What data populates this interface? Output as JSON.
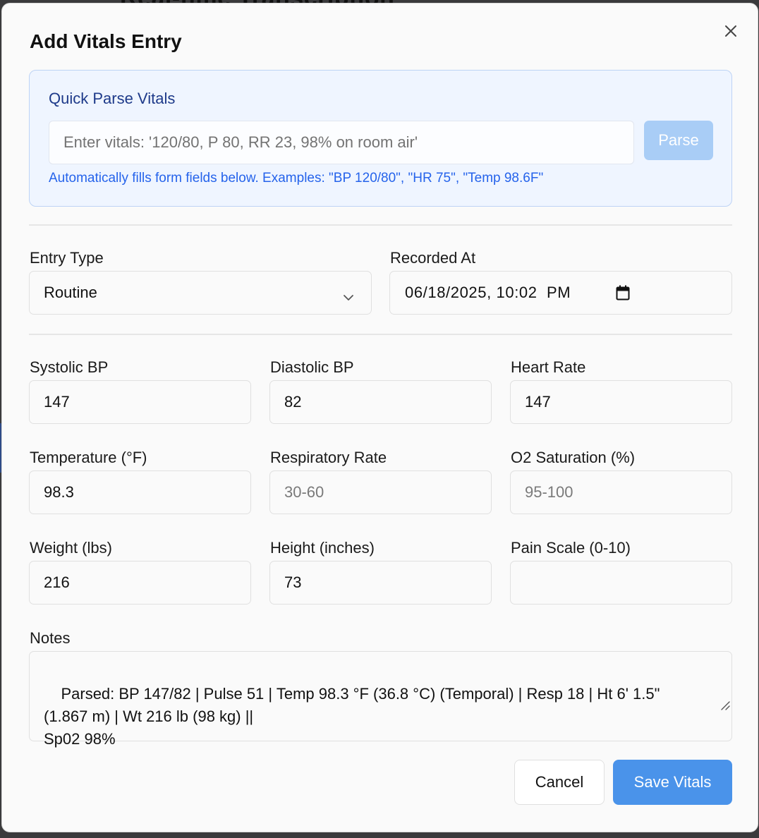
{
  "backdrop": {
    "title_fragment": "Real-time Transcription"
  },
  "dialog": {
    "title": "Add Vitals Entry"
  },
  "quick_parse": {
    "title": "Quick Parse Vitals",
    "input_placeholder": "Enter vitals: '120/80, P 80, RR 23, 98% on room air'",
    "input_value": "",
    "parse_label": "Parse",
    "hint": "Automatically fills form fields below. Examples: \"BP 120/80\", \"HR 75\", \"Temp 98.6F\""
  },
  "entry_type": {
    "label": "Entry Type",
    "value": "Routine"
  },
  "recorded_at": {
    "label": "Recorded At",
    "value": "06/18/2025, 10:02  PM"
  },
  "fields": {
    "systolic": {
      "label": "Systolic BP",
      "value": "147",
      "placeholder": ""
    },
    "diastolic": {
      "label": "Diastolic BP",
      "value": "82",
      "placeholder": ""
    },
    "heart_rate": {
      "label": "Heart Rate",
      "value": "147",
      "placeholder": ""
    },
    "temperature": {
      "label": "Temperature (°F)",
      "value": "98.3",
      "placeholder": ""
    },
    "respiratory": {
      "label": "Respiratory Rate",
      "value": "",
      "placeholder": "30-60"
    },
    "o2": {
      "label": "O2 Saturation (%)",
      "value": "",
      "placeholder": "95-100"
    },
    "weight": {
      "label": "Weight (lbs)",
      "value": "216",
      "placeholder": ""
    },
    "height": {
      "label": "Height (inches)",
      "value": "73",
      "placeholder": ""
    },
    "pain": {
      "label": "Pain Scale (0-10)",
      "value": "",
      "placeholder": ""
    }
  },
  "notes": {
    "label": "Notes",
    "value": "Parsed: BP 147/82 | Pulse 51 | Temp 98.3 °F (36.8 °C) (Temporal) | Resp 18 | Ht 6' 1.5\"\n(1.867 m) | Wt 216 lb (98 kg) ||\nSp02 98%"
  },
  "actions": {
    "cancel_label": "Cancel",
    "save_label": "Save Vitals"
  },
  "colors": {
    "accent": "#4a93ea",
    "parse_disabled": "#a9cdf6",
    "quick_parse_bg": "#eff5ff",
    "quick_parse_title": "#1e3a8a",
    "hint_text": "#2563eb"
  },
  "icons": {
    "close": "close-icon",
    "chevron": "chevron-down-icon",
    "calendar": "calendar-icon",
    "resize": "resize-handle-icon"
  }
}
